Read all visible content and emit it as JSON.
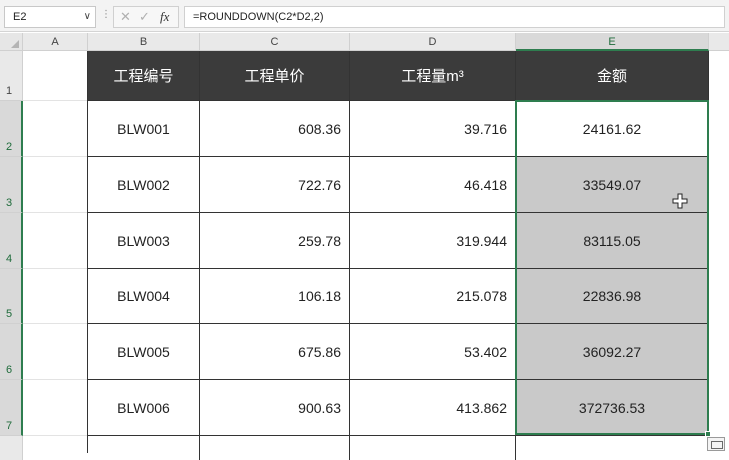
{
  "formula_bar": {
    "name_box": "E2",
    "formula": "=ROUNDDOWN(C2*D2,2)",
    "fx_label": "fx",
    "cancel_glyph": "✕",
    "enter_glyph": "✓"
  },
  "columns": [
    "A",
    "B",
    "C",
    "D",
    "E"
  ],
  "rows": [
    "1",
    "2",
    "3",
    "4",
    "5",
    "6",
    "7"
  ],
  "table": {
    "headers": [
      "工程编号",
      "工程单价",
      "工程量m³",
      "金额"
    ],
    "rows": [
      [
        "BLW001",
        "608.36",
        "39.716",
        "24161.62"
      ],
      [
        "BLW002",
        "722.76",
        "46.418",
        "33549.07"
      ],
      [
        "BLW003",
        "259.78",
        "319.944",
        "83115.05"
      ],
      [
        "BLW004",
        "106.18",
        "215.078",
        "22836.98"
      ],
      [
        "BLW005",
        "675.86",
        "53.402",
        "36092.27"
      ],
      [
        "BLW006",
        "900.63",
        "413.862",
        "372736.53"
      ]
    ]
  },
  "colors": {
    "header_bg": "#3b3b3b",
    "selection_bg": "#c9c9c9",
    "selection_border": "#2e7d4f"
  },
  "icons": {
    "cursor": "cell-select-cross-icon",
    "quick_analysis": "quick-analysis-icon"
  }
}
